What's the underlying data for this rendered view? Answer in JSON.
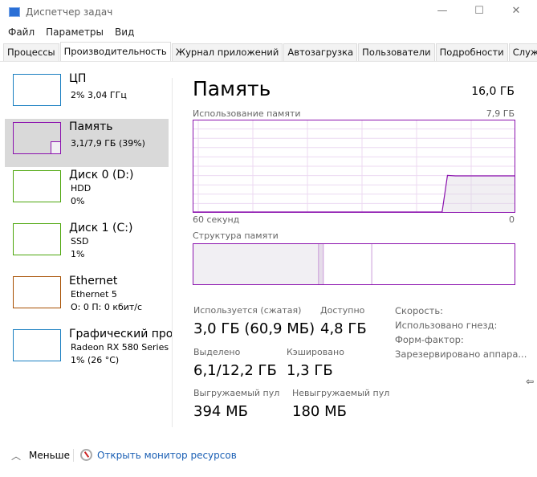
{
  "window": {
    "title": "Диспетчер задач",
    "minimize_icon": "minimize-icon",
    "maximize_icon": "maximize-icon",
    "close_icon": "close-icon"
  },
  "menu": [
    "Файл",
    "Параметры",
    "Вид"
  ],
  "tabs": [
    {
      "label": "Процессы"
    },
    {
      "label": "Производительность",
      "active": true
    },
    {
      "label": "Журнал приложений"
    },
    {
      "label": "Автозагрузка"
    },
    {
      "label": "Пользователи"
    },
    {
      "label": "Подробности"
    },
    {
      "label": "Службы"
    }
  ],
  "sidebar": [
    {
      "title": "ЦП",
      "line1": "2% 3,04 ГГц",
      "line2": "",
      "color": "#1a7fc1"
    },
    {
      "title": "Память",
      "line1": "3,1/7,9 ГБ (39%)",
      "line2": "",
      "color": "#8b12ae",
      "selected": true
    },
    {
      "title": "Диск 0 (D:)",
      "line1": "HDD",
      "line2": "0%",
      "color": "#4da60c"
    },
    {
      "title": "Диск 1 (C:)",
      "line1": "SSD",
      "line2": "1%",
      "color": "#4da60c"
    },
    {
      "title": "Ethernet",
      "line1": "Ethernet 5",
      "line2": "О: 0 П: 0 кбит/с",
      "color": "#a74f01"
    },
    {
      "title": "Графический про",
      "line1": "Radeon RX 580 Series",
      "line2": "1% (26 °C)",
      "color": "#1a7fc1"
    }
  ],
  "main": {
    "title": "Память",
    "total": "16,0 ГБ",
    "usage_label": "Использование памяти",
    "usage_max": "7,9 ГБ",
    "time_left": "60 секунд",
    "time_right": "0",
    "structure_label": "Структура памяти",
    "accent": "#8b12ae",
    "usage_history": [
      {
        "seconds_ago": 60,
        "percent": 0
      },
      {
        "seconds_ago": 13.5,
        "percent": 0
      },
      {
        "seconds_ago": 12.5,
        "percent": 40
      },
      {
        "seconds_ago": 11,
        "percent": 39.5
      },
      {
        "seconds_ago": 0,
        "percent": 39.5
      }
    ],
    "structure_percent": {
      "in_use": 39,
      "modified": 1.5,
      "standby": 15,
      "free": 44.5
    },
    "stats": {
      "in_use_label": "Используется (сжатая)",
      "in_use": "3,0 ГБ (60,9 МБ)",
      "available_label": "Доступно",
      "available": "4,8 ГБ",
      "committed_label": "Выделено",
      "committed": "6,1/12,2 ГБ",
      "cached_label": "Кэшировано",
      "cached": "1,3 ГБ",
      "paged_label": "Выгружаемый пул",
      "paged": "394 МБ",
      "nonpaged_label": "Невыгружаемый пул",
      "nonpaged": "180 МБ"
    },
    "info": [
      "Скорость:",
      "Использовано гнезд:",
      "Форм-фактор:",
      "Зарезервировано аппара..."
    ]
  },
  "footer": {
    "less": "Меньше",
    "monitor": "Открыть монитор ресурсов"
  }
}
